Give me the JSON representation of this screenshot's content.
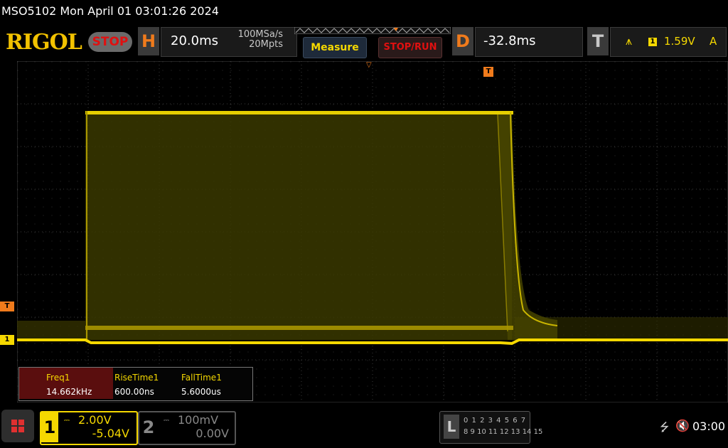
{
  "status": {
    "title": "MSO5102  Mon April 01 03:01:26 2024"
  },
  "header": {
    "logo": "RIGOL",
    "run_state": "STOP",
    "horizontal": {
      "letter": "H",
      "timebase": "20.0ms",
      "sample_rate": "100MSa/s",
      "memory_depth": "20Mpts"
    },
    "measure_label": "Measure",
    "stoprun_label": "STOP/RUN",
    "delay": {
      "letter": "D",
      "value": "-32.8ms"
    },
    "trigger": {
      "letter": "T",
      "channel": "1",
      "level": "1.59V",
      "mode": "A"
    }
  },
  "markers": {
    "trigger_level": "T",
    "channel1": "1"
  },
  "measurements": {
    "headers": [
      "Freq1",
      "RiseTime1",
      "FallTime1"
    ],
    "values": [
      "14.662kHz",
      "600.00ns",
      "5.6000us"
    ]
  },
  "channels": {
    "ch1": {
      "number": "1",
      "scale": "2.00V",
      "offset": "-5.04V",
      "color": "#f5d800"
    },
    "ch2": {
      "number": "2",
      "scale": "100mV",
      "offset": "0.00V",
      "color": "#888888"
    }
  },
  "logic": {
    "letter": "L",
    "row1": "0 1 2 3  4 5 6 7",
    "row2": "8 9 10 11 12 13 14 15"
  },
  "clock": "03:00",
  "colors": {
    "accent": "#f07b1c",
    "trace": "#f5d800",
    "alert": "#e01010"
  }
}
